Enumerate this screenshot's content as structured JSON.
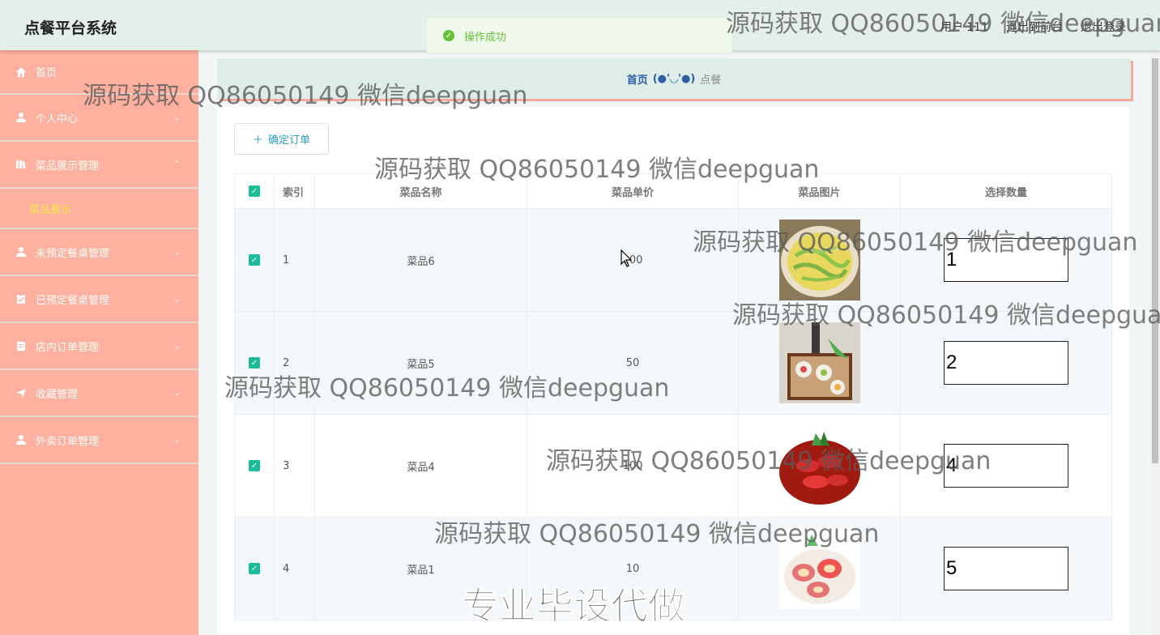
{
  "header": {
    "brand": "点餐平台系统",
    "user": "用户 111",
    "goto_front": "退出到前台",
    "logout": "退出登录"
  },
  "toast": {
    "message": "操作成功"
  },
  "sidebar": {
    "items": [
      {
        "label": "首页",
        "icon": "home-icon"
      },
      {
        "label": "个人中心",
        "icon": "user-icon"
      },
      {
        "label": "菜品展示管理",
        "icon": "book-icon",
        "expanded": true,
        "children": [
          {
            "label": "菜品展示"
          }
        ]
      },
      {
        "label": "未预定餐桌管理",
        "icon": "user-icon"
      },
      {
        "label": "已预定餐桌管理",
        "icon": "clipboard-icon"
      },
      {
        "label": "店内订单管理",
        "icon": "clipboard-icon"
      },
      {
        "label": "收藏管理",
        "icon": "send-icon"
      },
      {
        "label": "外卖订单管理",
        "icon": "user-icon"
      }
    ]
  },
  "breadcrumb": {
    "home": "首页",
    "face": "(●'◡'●)",
    "current": "点餐"
  },
  "toolbar": {
    "confirm_label": "确定订单"
  },
  "table": {
    "headers": [
      "索引",
      "菜品名称",
      "菜品单价",
      "菜品图片",
      "选择数量"
    ],
    "rows": [
      {
        "index": "1",
        "name": "菜品6",
        "price": "100",
        "qty": "1",
        "img": "noodles-dish"
      },
      {
        "index": "2",
        "name": "菜品5",
        "price": "50",
        "qty": "2",
        "img": "sushi-dish"
      },
      {
        "index": "3",
        "name": "菜品4",
        "price": "100",
        "qty": "4",
        "img": "crayfish-dish"
      },
      {
        "index": "4",
        "name": "菜品1",
        "price": "10",
        "qty": "5",
        "img": "shell-dish"
      }
    ]
  },
  "watermarks": {
    "text": "源码获取 QQ86050149 微信deepguan",
    "big": "专业毕设代做"
  },
  "colors": {
    "sidebar_bg": "#ffb09e",
    "topbar_bg": "#e4efec",
    "accent": "#1abc9c",
    "submenu_active": "#f7e94a",
    "success": "#67c23a"
  }
}
